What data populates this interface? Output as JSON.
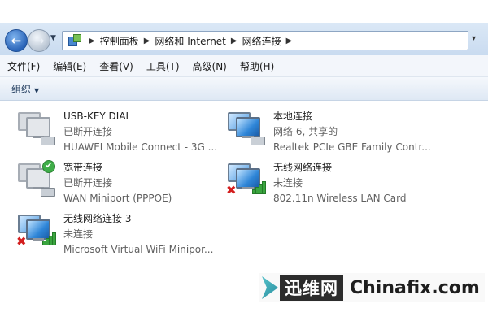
{
  "address_bar": {
    "breadcrumbs": [
      "控制面板",
      "网络和 Internet",
      "网络连接"
    ]
  },
  "menu": [
    "文件(F)",
    "编辑(E)",
    "查看(V)",
    "工具(T)",
    "高级(N)",
    "帮助(H)"
  ],
  "command_bar": {
    "organize_label": "组织"
  },
  "connections": [
    {
      "name": "USB-KEY DIAL",
      "status": "已断开连接",
      "device": "HUAWEI Mobile Connect - 3G ..."
    },
    {
      "name": "本地连接",
      "status": "网络  6, 共享的",
      "device": "Realtek PCIe GBE Family Contr..."
    },
    {
      "name": "宽带连接",
      "status": "已断开连接",
      "device": "WAN Miniport (PPPOE)"
    },
    {
      "name": "无线网络连接",
      "status": "未连接",
      "device": "802.11n Wireless LAN Card"
    },
    {
      "name": "无线网络连接 3",
      "status": "未连接",
      "device": "Microsoft Virtual WiFi Minipor..."
    }
  ],
  "watermark": {
    "cn": "迅维网",
    "en": "Chinafix.com"
  },
  "icons": {
    "back": "back-arrow-icon",
    "forward": "forward-arrow-icon",
    "control_panel": "control-panel-icon",
    "dialup": "dialup-connection-icon",
    "lan": "lan-connection-icon",
    "broadband": "broadband-connection-icon",
    "wireless": "wireless-connection-icon",
    "disconnected": "red-x-icon",
    "connected": "green-check-icon"
  },
  "colors": {
    "status_text": "#606060",
    "error_x": "#d31e1e",
    "signal_green": "#3aa53f"
  }
}
